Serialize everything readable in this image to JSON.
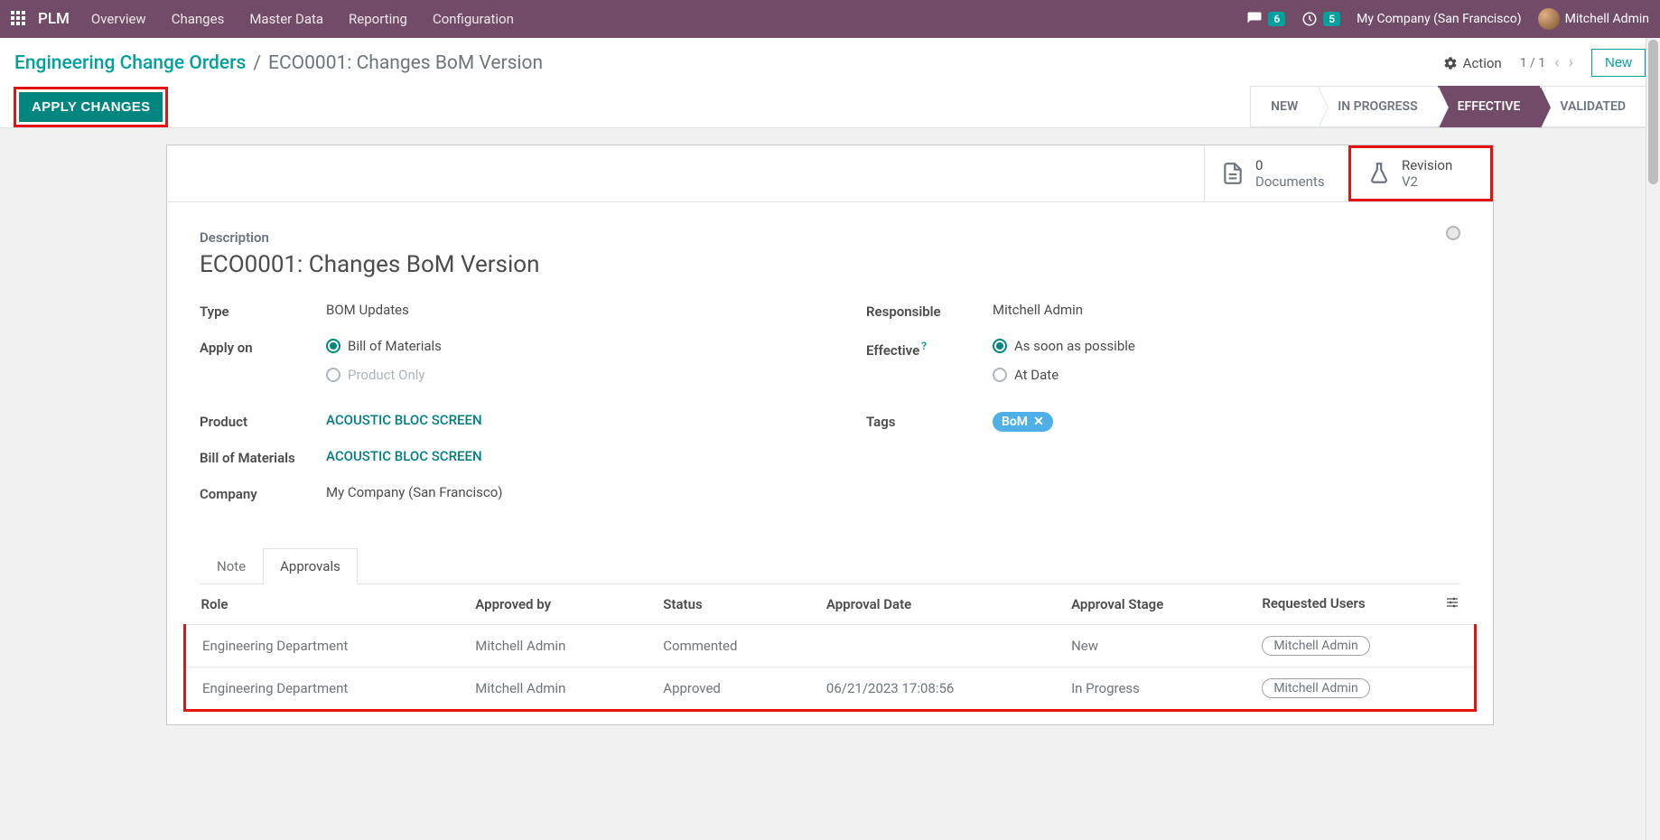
{
  "nav": {
    "app": "PLM",
    "links": [
      "Overview",
      "Changes",
      "Master Data",
      "Reporting",
      "Configuration"
    ],
    "msg_count": "6",
    "activity_count": "5",
    "company": "My Company (San Francisco)",
    "user": "Mitchell Admin"
  },
  "breadcrumb": {
    "root": "Engineering Change Orders",
    "sep": "/",
    "current": "ECO0001: Changes BoM Version"
  },
  "titlebar": {
    "action": "Action",
    "pager": "1 / 1",
    "new": "New"
  },
  "toolbar": {
    "apply": "APPLY CHANGES"
  },
  "stages": {
    "new": "NEW",
    "in_progress": "IN PROGRESS",
    "effective": "EFFECTIVE",
    "validated": "VALIDATED"
  },
  "smart": {
    "documents_count": "0",
    "documents_label": "Documents",
    "revision_label": "Revision",
    "revision_value": "V2"
  },
  "desc": {
    "label": "Description",
    "value": "ECO0001: Changes  BoM Version"
  },
  "fields": {
    "type_label": "Type",
    "type_value": "BOM Updates",
    "apply_on_label": "Apply on",
    "apply_on_bom": "Bill of Materials",
    "apply_on_product": "Product Only",
    "product_label": "Product",
    "product_value": "ACOUSTIC BLOC SCREEN",
    "bom_label": "Bill of Materials",
    "bom_value": "ACOUSTIC BLOC SCREEN",
    "company_label": "Company",
    "company_value": "My Company (San Francisco)",
    "responsible_label": "Responsible",
    "responsible_value": "Mitchell Admin",
    "effective_label": "Effective",
    "effective_help": "?",
    "effective_asap": "As soon as possible",
    "effective_atdate": "At Date",
    "tags_label": "Tags",
    "tag_bom": "BoM"
  },
  "tabs": {
    "note": "Note",
    "approvals": "Approvals"
  },
  "table": {
    "headers": {
      "role": "Role",
      "approved_by": "Approved by",
      "status": "Status",
      "approval_date": "Approval Date",
      "approval_stage": "Approval Stage",
      "requested_users": "Requested Users"
    },
    "rows": [
      {
        "role": "Engineering Department",
        "approved_by": "Mitchell Admin",
        "status": "Commented",
        "date": "",
        "stage": "New",
        "requested": "Mitchell Admin"
      },
      {
        "role": "Engineering Department",
        "approved_by": "Mitchell Admin",
        "status": "Approved",
        "date": "06/21/2023 17:08:56",
        "stage": "In Progress",
        "requested": "Mitchell Admin"
      }
    ]
  }
}
